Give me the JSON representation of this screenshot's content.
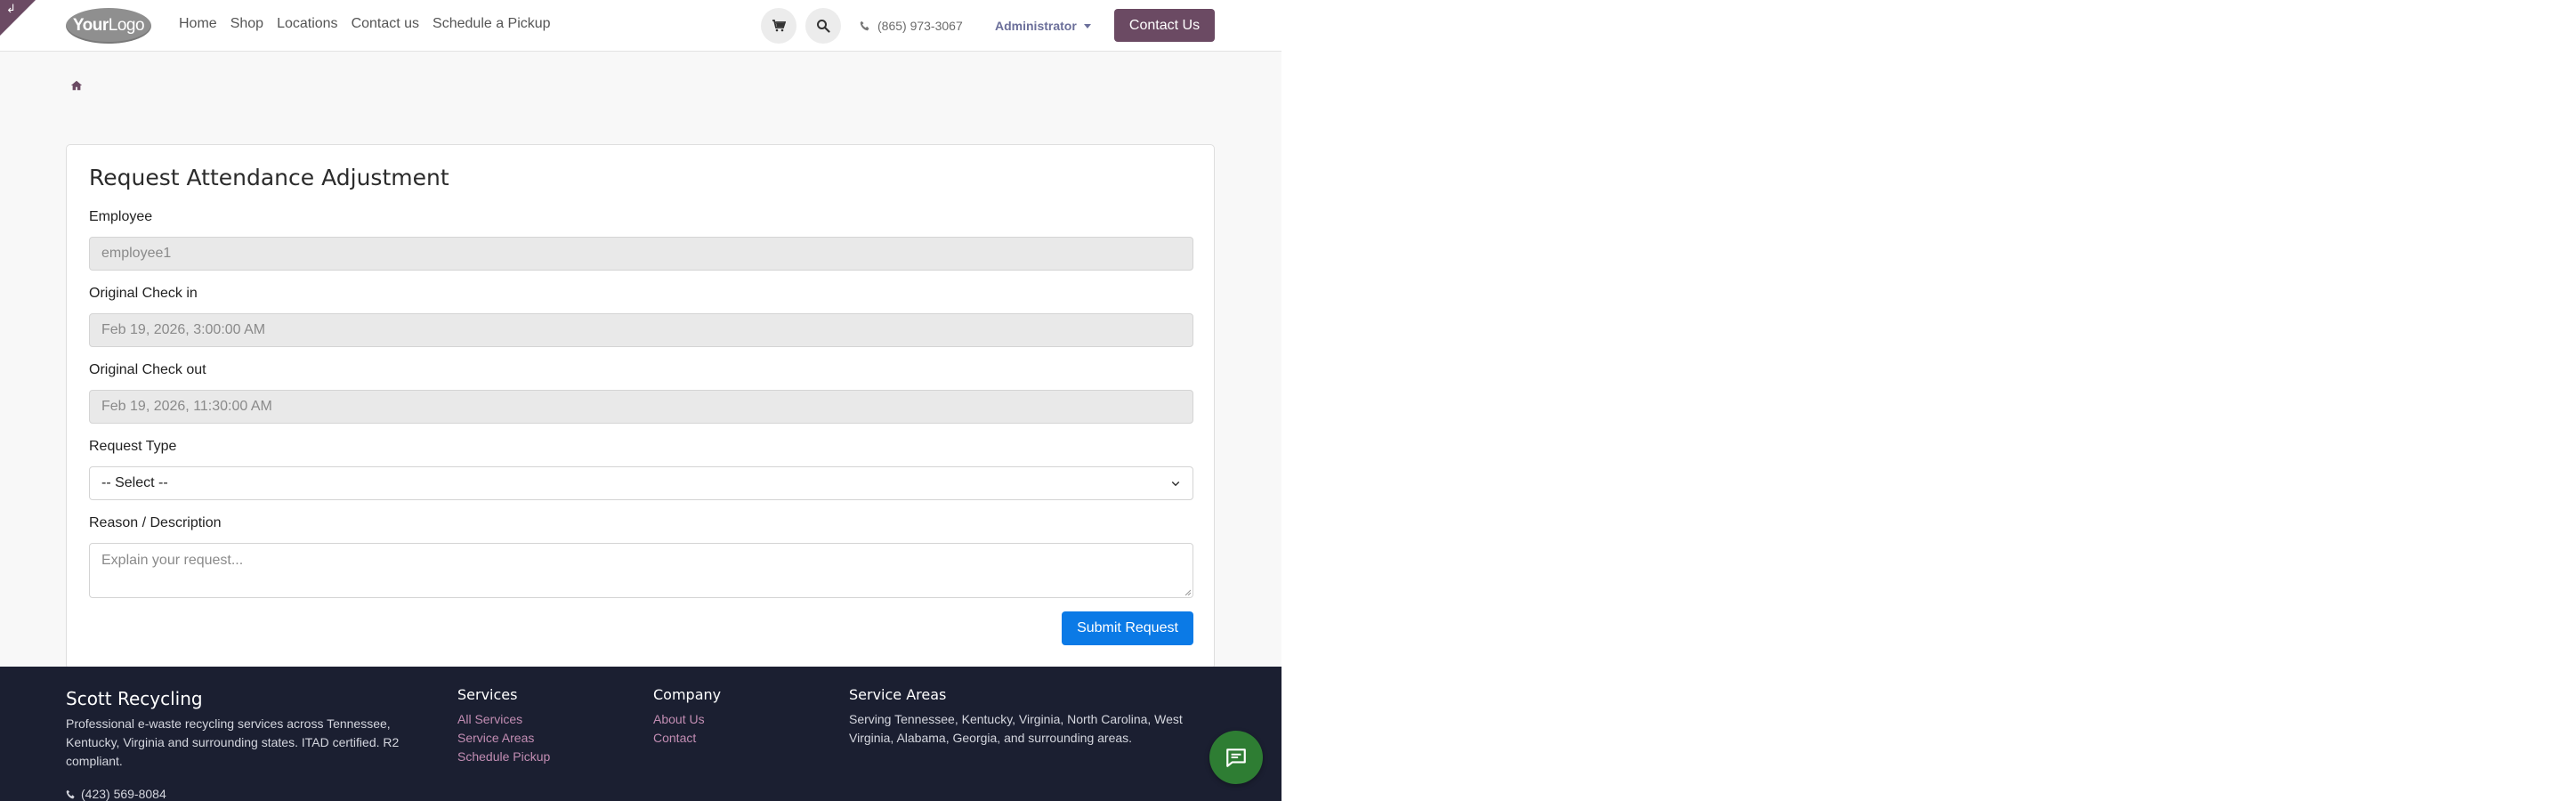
{
  "header": {
    "logo_bold": "Your",
    "logo_lite": "Logo",
    "nav": [
      "Home",
      "Shop",
      "Locations",
      "Contact us",
      "Schedule a Pickup"
    ],
    "phone": "(865) 973-3067",
    "user_menu": "Administrator",
    "contact_button": "Contact Us",
    "icons": [
      "cart-icon",
      "search-icon",
      "phone-icon",
      "home-icon"
    ]
  },
  "form": {
    "title": "Request Attendance Adjustment",
    "employee_label": "Employee",
    "employee_value": "employee1",
    "checkin_label": "Original Check in",
    "checkin_value": "Feb 19, 2026, 3:00:00 AM",
    "checkout_label": "Original Check out",
    "checkout_value": "Feb 19, 2026, 11:30:00 AM",
    "request_type_label": "Request Type",
    "request_type_value": "-- Select --",
    "reason_label": "Reason / Description",
    "reason_placeholder": "Explain your request...",
    "submit_label": "Submit Request"
  },
  "footer": {
    "brand": "Scott Recycling",
    "description": "Professional e-waste recycling services across Tennessee, Kentucky, Virginia and surrounding states. ITAD certified. R2 compliant.",
    "phone": "(423) 569-8084",
    "services_title": "Services",
    "services": [
      "All Services",
      "Service Areas",
      "Schedule Pickup"
    ],
    "company_title": "Company",
    "company": [
      "About Us",
      "Contact"
    ],
    "areas_title": "Service Areas",
    "areas_text": "Serving Tennessee, Kentucky, Virginia, North Carolina, West Virginia, Alabama, Georgia, and surrounding areas."
  },
  "colors": {
    "brand_primary": "#6b4a63",
    "submit_blue": "#0b7ae6",
    "footer_bg": "#1b1f31",
    "chat_green": "#2e7d33",
    "footer_link": "#c28db3"
  }
}
